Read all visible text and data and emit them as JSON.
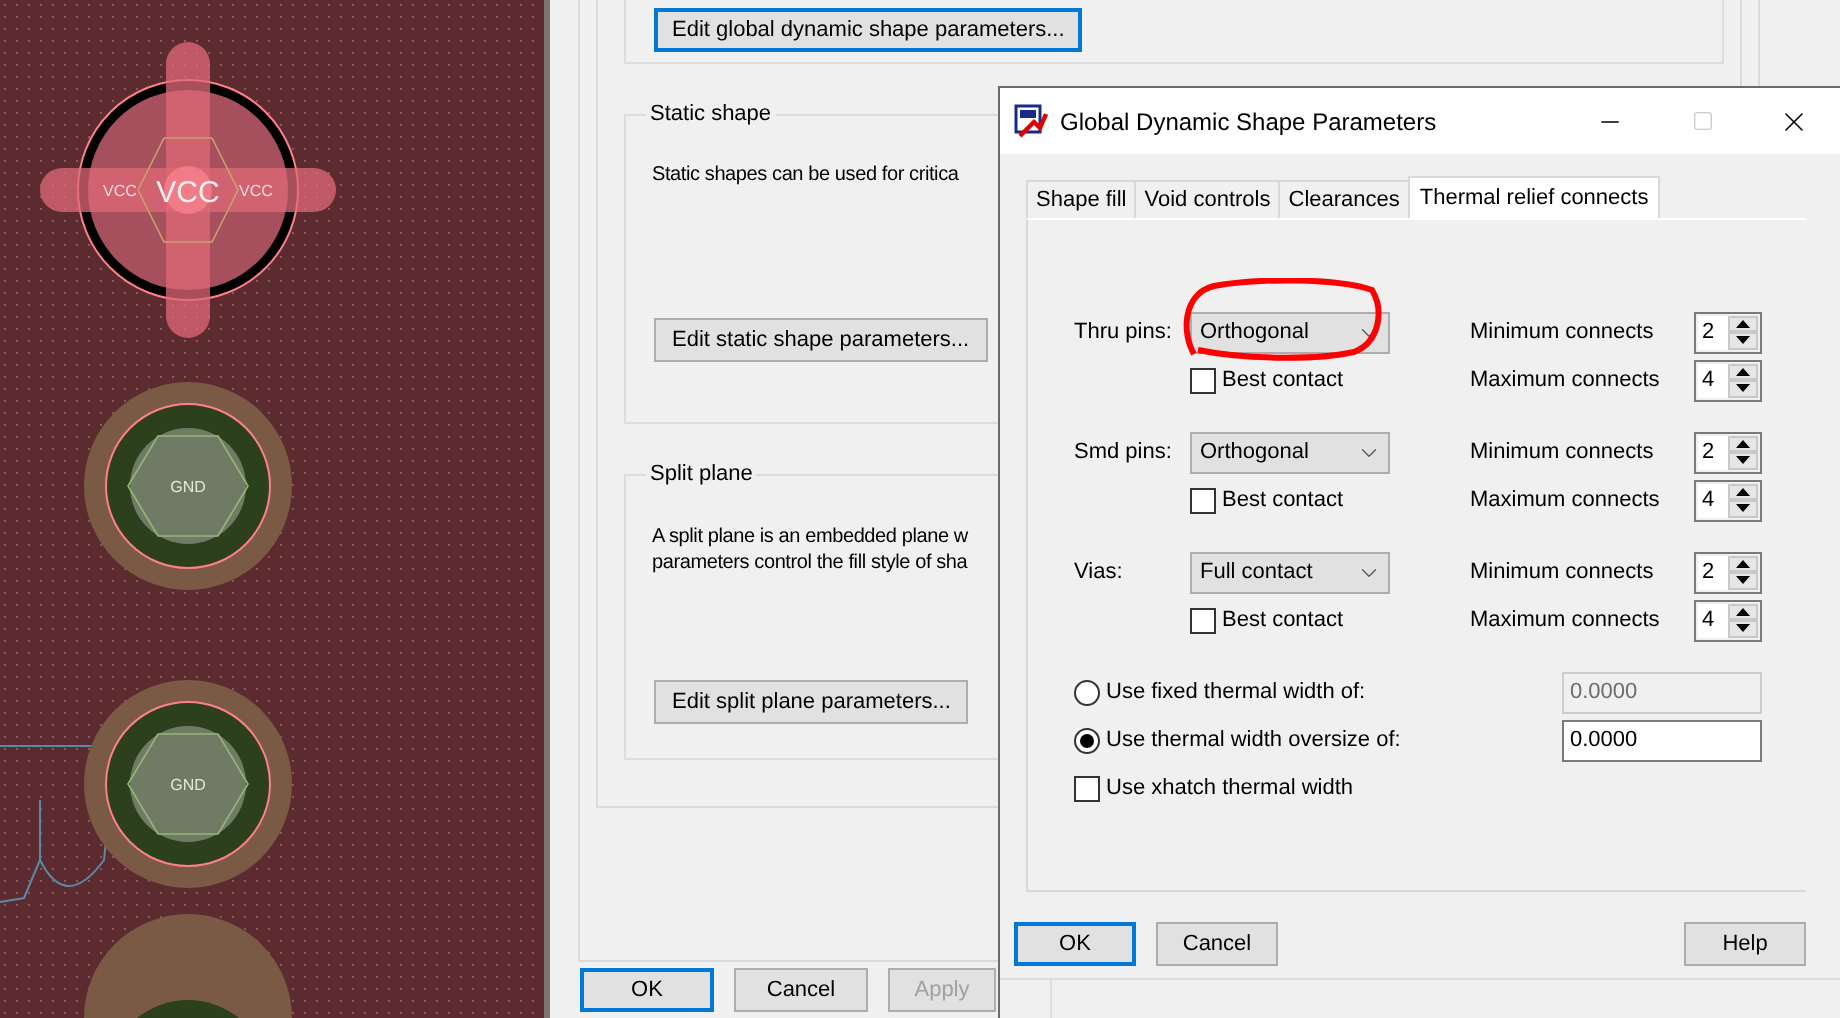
{
  "canvas": {
    "pads": [
      {
        "kind": "thermal",
        "label": "VCC",
        "side_labels": [
          "VCC",
          "VCC"
        ]
      },
      {
        "kind": "plain",
        "label": "GND"
      },
      {
        "kind": "plain",
        "label": "GND"
      },
      {
        "kind": "cut"
      }
    ]
  },
  "parent_dialog": {
    "top_button": {
      "label": "Edit global dynamic shape parameters...",
      "default": true
    },
    "groups": [
      {
        "title": "Static shape",
        "lines": [
          "Static shapes can be used for critica"
        ],
        "button": "Edit static shape parameters..."
      },
      {
        "title": "Split plane",
        "lines": [
          "A split plane is an embedded plane w",
          "parameters control the fill style of sha"
        ],
        "button": "Edit split plane parameters..."
      }
    ],
    "buttons": [
      {
        "label": "OK",
        "default": true,
        "disabled": false
      },
      {
        "label": "Cancel",
        "default": false,
        "disabled": false
      },
      {
        "label": "Apply",
        "default": false,
        "disabled": true
      }
    ]
  },
  "dialog": {
    "title": "Global Dynamic Shape Parameters",
    "tabs": [
      {
        "label": "Shape fill",
        "selected": false
      },
      {
        "label": "Void controls",
        "selected": false
      },
      {
        "label": "Clearances",
        "selected": false
      },
      {
        "label": "Thermal relief connects",
        "selected": true
      }
    ],
    "connect_rows": [
      {
        "label": "Thru pins:",
        "value": "Orthogonal",
        "best_contact": {
          "label": "Best contact",
          "checked": false
        },
        "min_label": "Minimum connects",
        "min": "2",
        "max_label": "Maximum connects",
        "max": "4",
        "highlighted": true
      },
      {
        "label": "Smd pins:",
        "value": "Orthogonal",
        "best_contact": {
          "label": "Best contact",
          "checked": false
        },
        "min_label": "Minimum connects",
        "min": "2",
        "max_label": "Maximum connects",
        "max": "4",
        "highlighted": false
      },
      {
        "label": "Vias:",
        "value": "Full contact",
        "best_contact": {
          "label": "Best contact",
          "checked": false
        },
        "min_label": "Minimum connects",
        "min": "2",
        "max_label": "Maximum connects",
        "max": "4",
        "highlighted": false
      }
    ],
    "width_options": [
      {
        "kind": "radio",
        "label": "Use fixed thermal width of:",
        "selected": false,
        "value": "0.0000",
        "disabled": true
      },
      {
        "kind": "radio",
        "label": "Use thermal width oversize of:",
        "selected": true,
        "value": "0.0000",
        "disabled": false
      },
      {
        "kind": "checkbox",
        "label": "Use xhatch thermal width",
        "checked": false
      }
    ],
    "buttons": [
      {
        "label": "OK",
        "default": true,
        "kind": "left"
      },
      {
        "label": "Cancel",
        "default": false,
        "kind": "left"
      },
      {
        "label": "Help",
        "default": false,
        "kind": "right"
      }
    ]
  }
}
